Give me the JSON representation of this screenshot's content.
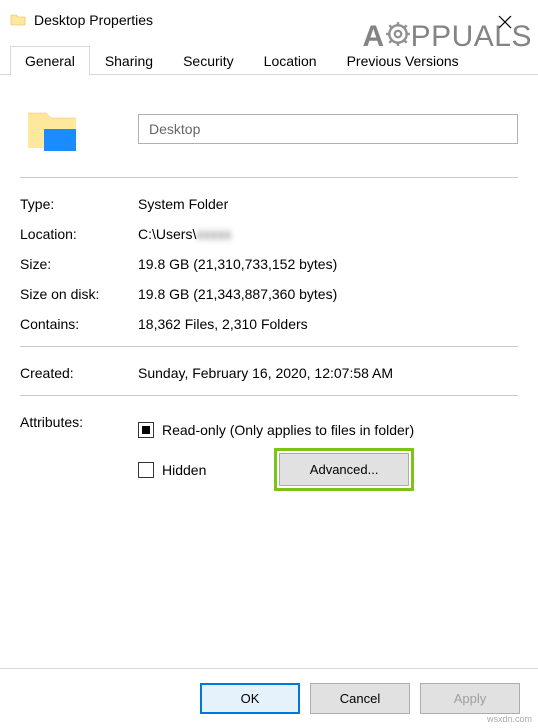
{
  "window": {
    "title": "Desktop Properties"
  },
  "watermark": {
    "prefix": "A",
    "suffix": "PPUALS"
  },
  "small_watermark": "wsxdn.com",
  "tabs": {
    "general": "General",
    "sharing": "Sharing",
    "security": "Security",
    "location": "Location",
    "previous": "Previous Versions"
  },
  "name_field": {
    "value": "Desktop"
  },
  "props": {
    "type_label": "Type:",
    "type_value": "System Folder",
    "location_label": "Location:",
    "location_value": "C:\\Users\\",
    "location_obscured": "xxxxx",
    "size_label": "Size:",
    "size_value": "19.8 GB (21,310,733,152 bytes)",
    "sizeondisk_label": "Size on disk:",
    "sizeondisk_value": "19.8 GB (21,343,887,360 bytes)",
    "contains_label": "Contains:",
    "contains_value": "18,362 Files, 2,310 Folders",
    "created_label": "Created:",
    "created_value": "Sunday, February 16, 2020, 12:07:58 AM",
    "attributes_label": "Attributes:",
    "readonly_label": "Read-only (Only applies to files in folder)",
    "hidden_label": "Hidden",
    "advanced_button": "Advanced..."
  },
  "buttons": {
    "ok": "OK",
    "cancel": "Cancel",
    "apply": "Apply"
  }
}
